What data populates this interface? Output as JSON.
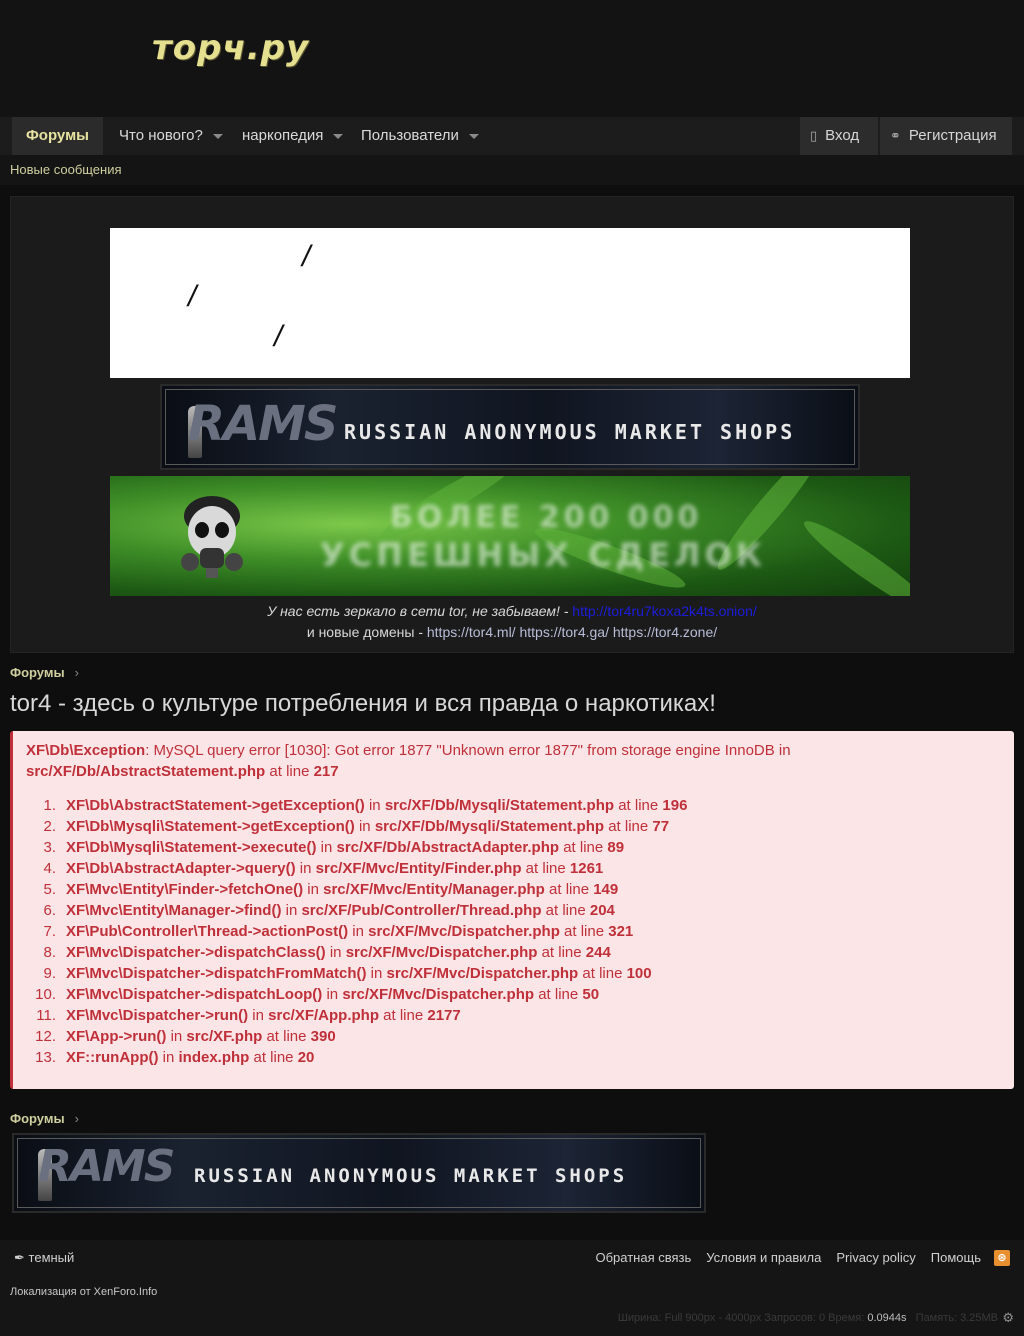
{
  "site": {
    "logo": "торч.ру"
  },
  "nav": {
    "tabs": [
      {
        "label": "Форумы"
      },
      {
        "label": "Что нового?"
      },
      {
        "label": "наркопедия"
      },
      {
        "label": "Пользователи"
      }
    ],
    "login": "Вход",
    "register": "Регистрация",
    "login_icon": "door-icon",
    "register_icon": "key-icon"
  },
  "subnav": {
    "new_messages": "Новые сообщения"
  },
  "banners": {
    "rams_logo": "RAMS",
    "rams_text": "RUSSIAN ANONYMOUS MARKET SHOPS",
    "weed_line1": "БОЛЕЕ 200 000",
    "weed_line2": "УСПЕШНЫХ СДЕЛОК"
  },
  "mirror": {
    "text1": "У нас есть зеркало в сети tor, не забываем! - ",
    "onion_link": "http://tor4ru7koxa2k4ts.onion/",
    "text2": "и новые домены - ",
    "domains": "https://tor4.ml/ https://tor4.ga/ https://tor4.zone/"
  },
  "breadcrumb": "Форумы",
  "page_title": "tor4 - здесь о культуре потребления и вся правда о наркотиках!",
  "error": {
    "exception": "XF\\Db\\Exception",
    "message": ": MySQL query error [1030]: Got error 1877 \"Unknown error 1877\" from storage engine InnoDB in ",
    "file": "src/XF/Db/AbstractStatement.php",
    "at_line": " at line ",
    "line": "217",
    "trace": [
      {
        "n": "1.",
        "fn": "XF\\Db\\AbstractStatement->getException()",
        "file": "src/XF/Db/Mysqli/Statement.php",
        "line": "196"
      },
      {
        "n": "2.",
        "fn": "XF\\Db\\Mysqli\\Statement->getException()",
        "file": "src/XF/Db/Mysqli/Statement.php",
        "line": "77"
      },
      {
        "n": "3.",
        "fn": "XF\\Db\\Mysqli\\Statement->execute()",
        "file": "src/XF/Db/AbstractAdapter.php",
        "line": "89"
      },
      {
        "n": "4.",
        "fn": "XF\\Db\\AbstractAdapter->query()",
        "file": "src/XF/Mvc/Entity/Finder.php",
        "line": "1261"
      },
      {
        "n": "5.",
        "fn": "XF\\Mvc\\Entity\\Finder->fetchOne()",
        "file": "src/XF/Mvc/Entity/Manager.php",
        "line": "149"
      },
      {
        "n": "6.",
        "fn": "XF\\Mvc\\Entity\\Manager->find()",
        "file": "src/XF/Pub/Controller/Thread.php",
        "line": "204"
      },
      {
        "n": "7.",
        "fn": "XF\\Pub\\Controller\\Thread->actionPost()",
        "file": "src/XF/Mvc/Dispatcher.php",
        "line": "321"
      },
      {
        "n": "8.",
        "fn": "XF\\Mvc\\Dispatcher->dispatchClass()",
        "file": "src/XF/Mvc/Dispatcher.php",
        "line": "244"
      },
      {
        "n": "9.",
        "fn": "XF\\Mvc\\Dispatcher->dispatchFromMatch()",
        "file": "src/XF/Mvc/Dispatcher.php",
        "line": "100"
      },
      {
        "n": "10.",
        "fn": "XF\\Mvc\\Dispatcher->dispatchLoop()",
        "file": "src/XF/Mvc/Dispatcher.php",
        "line": "50"
      },
      {
        "n": "11.",
        "fn": "XF\\Mvc\\Dispatcher->run()",
        "file": "src/XF/App.php",
        "line": "2177"
      },
      {
        "n": "12.",
        "fn": "XF\\App->run()",
        "file": "src/XF.php",
        "line": "390"
      },
      {
        "n": "13.",
        "fn": "XF::runApp()",
        "file": "index.php",
        "line": "20"
      }
    ]
  },
  "footer": {
    "style_chooser": "темный",
    "links": [
      "Обратная связь",
      "Условия и правила",
      "Privacy policy",
      "Помощь"
    ],
    "localization": "Локализация от XenForo.Info",
    "stats_muted": "Ширина: Full 900px - 4000px  Запросов: 0  Время:",
    "stats_time": "0.0944s",
    "stats_memory": "Память: 3.25MB"
  },
  "colors": {
    "accent": "#e8e3a0",
    "error": "#c0303a",
    "error_bg": "#fbe5e6"
  }
}
